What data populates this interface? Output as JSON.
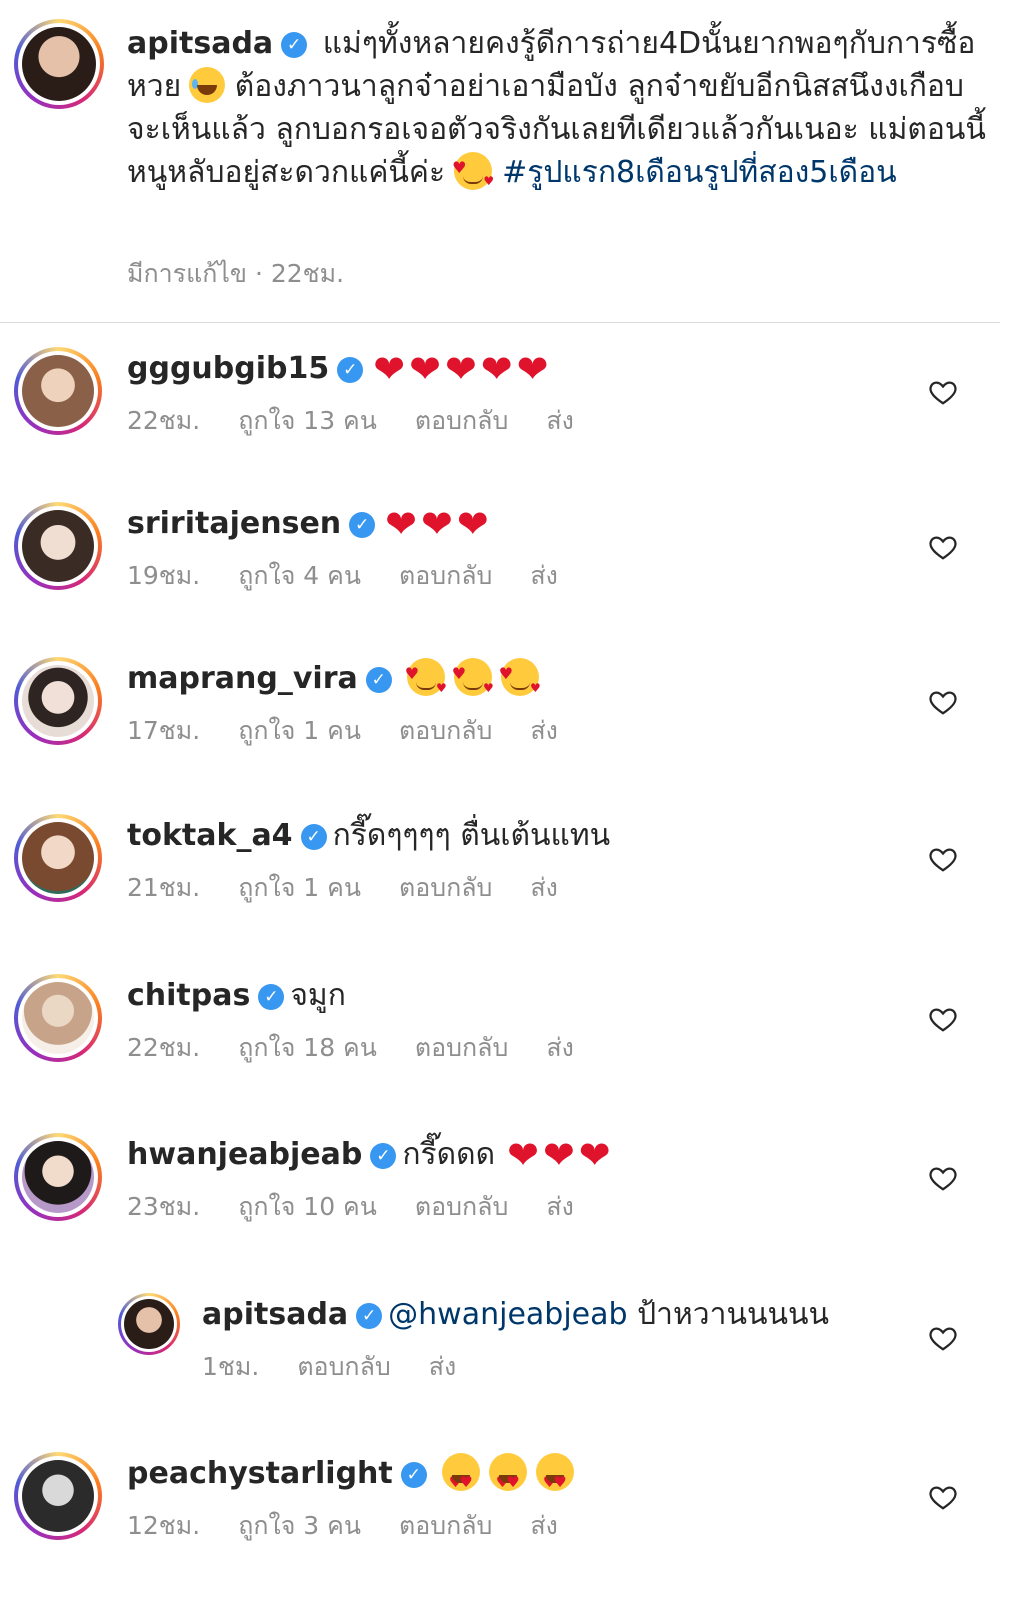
{
  "post": {
    "username": "apitsada",
    "caption_text": "แม่ๆทั้งหลายคงรู้ดีการถ่าย4Dนั้นยากพอๆกับการซื้อหวย",
    "caption_text_2": " ต้องภาวนาลูกจ๋าอย่าเอามือบัง ลูกจ๋าขยับอีกนิสสนึงงเกือบจะเห็นแล้ว ลูกบอกรอเจอตัวจริงกันเลยทีเดียวแล้วกันเนอะ แม่ตอนนี้หนูหลับอยู่สะดวกแค่นี้ค่ะ",
    "hashtag": "#รูปแรก8เดือนรูปที่สอง5เดือน",
    "edited_label": "มีการแก้ไข · 22ชม."
  },
  "comments": [
    {
      "username": "gggubgib15",
      "text": "",
      "emojis": "hearts5",
      "time": "22ชม.",
      "likes": "ถูกใจ 13 คน",
      "reply": "ตอบกลับ",
      "send": "ส่ง",
      "avatar_color": "#c49a7a"
    },
    {
      "username": "sriritajensen",
      "text": "",
      "emojis": "hearts3",
      "time": "19ชม.",
      "likes": "ถูกใจ 4 คน",
      "reply": "ตอบกลับ",
      "send": "ส่ง",
      "avatar_color": "#d9c2b0"
    },
    {
      "username": "maprang_vira",
      "text": "",
      "emojis": "eyes3",
      "time": "17ชม.",
      "likes": "ถูกใจ 1 คน",
      "reply": "ตอบกลับ",
      "send": "ส่ง",
      "avatar_color": "#e6d6cf"
    },
    {
      "username": "toktak_a4",
      "text": "กรี๊ดๆๆๆๆ ตื่นเต้นแทน",
      "emojis": "",
      "time": "21ชม.",
      "likes": "ถูกใจ 1 คน",
      "reply": "ตอบกลับ",
      "send": "ส่ง",
      "avatar_color": "#b88c70"
    },
    {
      "username": "chitpas",
      "text": "จมูก",
      "emojis": "",
      "time": "22ชม.",
      "likes": "ถูกใจ 18 คน",
      "reply": "ตอบกลับ",
      "send": "ส่ง",
      "avatar_color": "#d8cabb"
    },
    {
      "username": "hwanjeabjeab",
      "text": "กรี๊ดดด",
      "emojis": "hearts3",
      "time": "23ชม.",
      "likes": "ถูกใจ 10 คน",
      "reply": "ตอบกลับ",
      "send": "ส่ง",
      "avatar_color": "#b799c9"
    }
  ],
  "reply_comment": {
    "username": "apitsada",
    "mention": "@hwanjeabjeab",
    "text": "ป้าหวานนนนน",
    "time": "1ชม.",
    "reply": "ตอบกลับ",
    "send": "ส่ง"
  },
  "last_comment": {
    "username": "peachystarlight",
    "emojis": "love3",
    "time": "12ชม.",
    "likes": "ถูกใจ 3 คน",
    "reply": "ตอบกลับ",
    "send": "ส่ง"
  },
  "colors": {
    "verified": "#3897f0",
    "link": "#00376b",
    "meta": "#8e8e8e",
    "heart_emoji": "#e0132c"
  }
}
